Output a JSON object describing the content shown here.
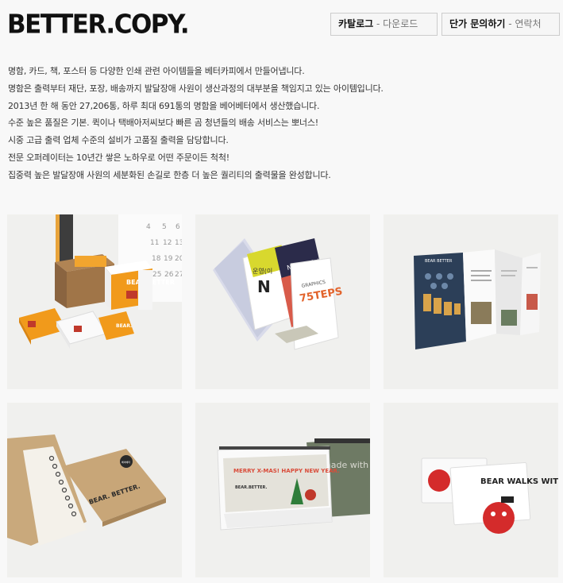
{
  "header": {
    "logo": "BETTER.COPY.",
    "buttons": [
      {
        "strong": "카탈로그",
        "sep": " - ",
        "light": "다운로드"
      },
      {
        "strong": "단가 문의하기",
        "sep": " - ",
        "light": "연락처"
      }
    ]
  },
  "intro": [
    "명함, 카드, 책, 포스터 등 다양한 인쇄 관련 아이템들을 베터카피에서 만들어냅니다.",
    "명함은 출력부터 재단, 포장, 배송까지 발달장애 사원이 생산과정의 대부분을 책임지고 있는 아이템입니다.",
    "2013년 한 해 동안 27,206통, 하루 최대 691통의 명함을 베어베터에서 생산했습니다.",
    "수준 높은 품질은 기본. 퀵이나 택배아저씨보다 빠른 곰 청년들의 배송 서비스는 뽀너스!",
    "시중 고급 출력 업체 수준의 설비가 고품질 출력을 담당합니다.",
    "전문 오퍼레이터는 10년간 쌓은 노하우로 어떤 주문이든 척척!",
    "집중력 높은 발달장애 사원의 세분화된 손길로 한층 더 높은 퀄리티의 출력물을 완성합니다."
  ],
  "gallery": {
    "namecards": {
      "title": "BEAR BETTER",
      "calendar_numbers": [
        "4",
        "5",
        "6",
        "11",
        "12",
        "13",
        "18",
        "19",
        "20",
        "25",
        "26",
        "27"
      ]
    },
    "booklets": {
      "cover_a": "운영(이",
      "cover_b": "New Training",
      "cover_c": "75TEPS",
      "cover_c_sub": "GRAPHICS"
    },
    "brochure": {
      "title": "BEAR BETTER"
    },
    "notebook": {
      "title": "BEAR. BETTER.",
      "badge": "베어베터"
    },
    "calendar": {
      "headline": "MERRY X-MAS! HAPPY NEW YEAR.",
      "brand": "BEAR.BETTER.",
      "back_text": "made with"
    },
    "cards": {
      "text": "BEAR WALKS WITH US"
    }
  }
}
